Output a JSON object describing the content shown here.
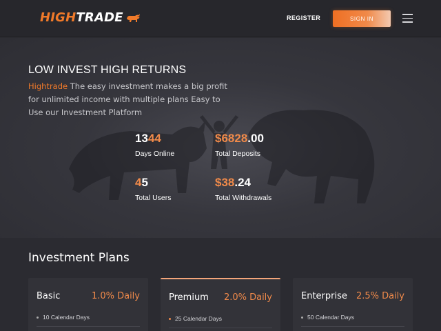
{
  "header": {
    "logo_part1": "HIGH",
    "logo_part2": "TRADE",
    "logo_icon": "bull-icon",
    "register_label": "REGISTER",
    "signin_label": "SIGN IN",
    "menu_icon": "hamburger-menu-icon"
  },
  "hero": {
    "title": "LOW INVEST HIGH RETURNS",
    "brand": "Hightrade",
    "subtitle": " The easy investment makes a big profit for unlimited income with multiple plans Easy to Use our Investment Platform",
    "stats": [
      {
        "value_main": "13",
        "value_accent": "44",
        "label": "Days Online"
      },
      {
        "value_main": "$6828",
        "value_accent": ".00",
        "label": "Total Deposits"
      },
      {
        "value_main": "4",
        "value_accent": "5",
        "label": "Total Users"
      },
      {
        "value_main": "$38",
        "value_accent": ".24",
        "label": "Total Withdrawals"
      }
    ]
  },
  "plans": {
    "title": "Investment Plans",
    "items": [
      {
        "name": "Basic",
        "rate": "1.0% Daily",
        "feature": "10 Calendar Days"
      },
      {
        "name": "Premium",
        "rate": "2.0% Daily",
        "feature": "25 Calendar Days"
      },
      {
        "name": "Enterprise",
        "rate": "2.5% Daily",
        "feature": "50 Calendar Days"
      }
    ]
  },
  "colors": {
    "accent": "#f07a2a",
    "background": "#2b2b31",
    "header": "#27272c"
  }
}
